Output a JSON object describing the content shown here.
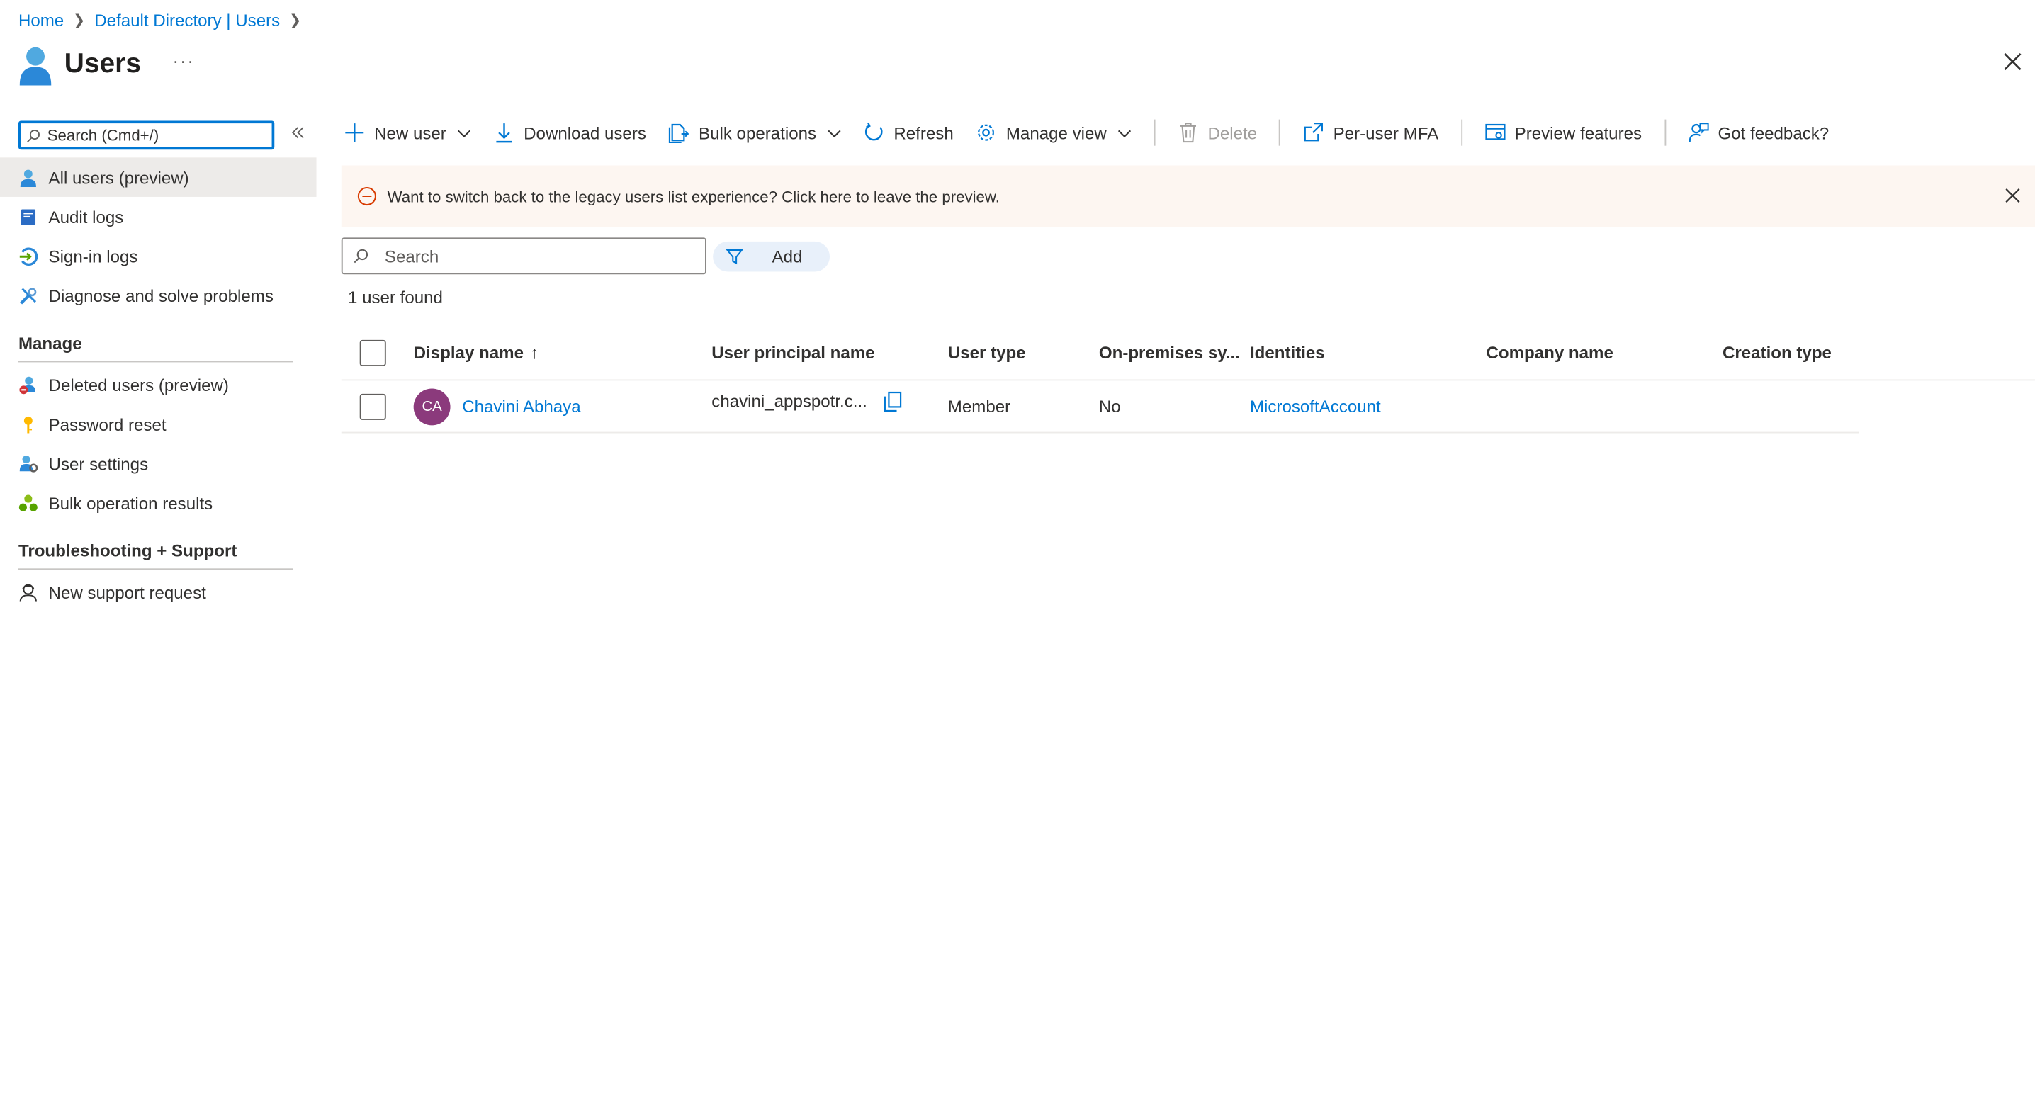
{
  "breadcrumb": {
    "home": "Home",
    "directory": "Default Directory | Users"
  },
  "page": {
    "title": "Users",
    "more": "···"
  },
  "sidebar": {
    "search_placeholder": "Search (Cmd+/)",
    "items": [
      {
        "label": "All users (preview)",
        "icon": "user-icon",
        "active": true
      },
      {
        "label": "Audit logs",
        "icon": "audit-log-icon"
      },
      {
        "label": "Sign-in logs",
        "icon": "sign-in-icon"
      },
      {
        "label": "Diagnose and solve problems",
        "icon": "wrench-icon"
      }
    ],
    "manage_title": "Manage",
    "manage_items": [
      {
        "label": "Deleted users (preview)",
        "icon": "deleted-user-icon"
      },
      {
        "label": "Password reset",
        "icon": "key-icon"
      },
      {
        "label": "User settings",
        "icon": "user-settings-icon"
      },
      {
        "label": "Bulk operation results",
        "icon": "bulk-results-icon"
      }
    ],
    "support_title": "Troubleshooting + Support",
    "support_items": [
      {
        "label": "New support request",
        "icon": "support-person-icon"
      }
    ]
  },
  "toolbar": {
    "new_user": "New user",
    "download_users": "Download users",
    "bulk_operations": "Bulk operations",
    "refresh": "Refresh",
    "manage_view": "Manage view",
    "delete": "Delete",
    "per_user_mfa": "Per-user MFA",
    "preview_features": "Preview features",
    "got_feedback": "Got feedback?"
  },
  "banner": {
    "text": "Want to switch back to the legacy users list experience? Click here to leave the preview."
  },
  "filter": {
    "search_placeholder": "Search",
    "add_label": "Add"
  },
  "result_count": "1 user found",
  "table": {
    "columns": [
      "Display name",
      "User principal name",
      "User type",
      "On-premises sy...",
      "Identities",
      "Company name",
      "Creation type"
    ],
    "sort_indicator": "↑",
    "rows": [
      {
        "initials": "CA",
        "display_name": "Chavini Abhaya",
        "upn": "chavini_appspotr.c...",
        "user_type": "Member",
        "on_prem": "No",
        "identities": "MicrosoftAccount",
        "company": "",
        "creation_type": ""
      }
    ]
  },
  "colors": {
    "accent": "#0078d4",
    "banner_bg": "#fdf6f1",
    "avatar": "#8b3a7c",
    "active_bg": "#edebe9"
  }
}
